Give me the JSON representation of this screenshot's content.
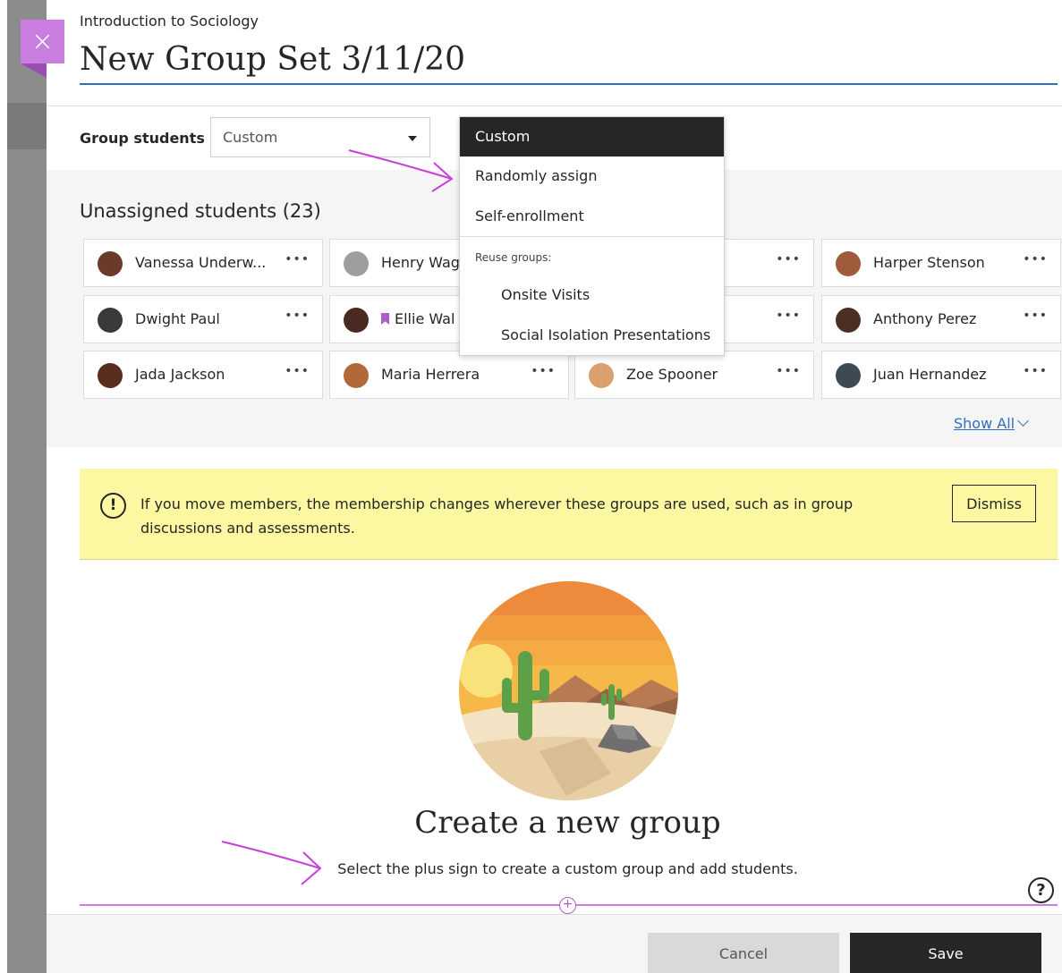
{
  "header": {
    "course_name": "Introduction to Sociology",
    "group_set_title": "New Group Set 3/11/20"
  },
  "grouping": {
    "label": "Group students",
    "selected": "Custom",
    "options": [
      {
        "label": "Custom",
        "selected": true
      },
      {
        "label": "Randomly assign",
        "selected": false
      },
      {
        "label": "Self-enrollment",
        "selected": false
      }
    ],
    "reuse_heading": "Reuse groups:",
    "reuse_options": [
      "Onsite Visits",
      "Social Isolation Presentations"
    ]
  },
  "students": {
    "heading": "Unassigned students (23)",
    "more_label": "•••",
    "show_all": "Show All",
    "list": [
      {
        "name": "Vanessa Underw...",
        "avatar_color": "#6b3a2a"
      },
      {
        "name": "Henry Wag",
        "avatar_color": "#9e9e9e"
      },
      {
        "name": "Harper Stenson",
        "avatar_color": "#a05a3c"
      },
      {
        "name": "Dwight Paul",
        "avatar_color": "#3a3a3a"
      },
      {
        "name": "Ellie Wal",
        "avatar_color": "#4a2a20",
        "flagged": true
      },
      {
        "name": "Anthony Perez",
        "avatar_color": "#4a3024"
      },
      {
        "name": "Jada Jackson",
        "avatar_color": "#5a2e1e"
      },
      {
        "name": "Maria Herrera",
        "avatar_color": "#b06a3a"
      },
      {
        "name": "Zoe Spooner",
        "avatar_color": "#d9a070"
      },
      {
        "name": "Juan Hernandez",
        "avatar_color": "#3e4a52"
      }
    ]
  },
  "notice": {
    "message": "If you move members, the membership changes wherever these groups are used, such as in group discussions and assessments.",
    "dismiss_label": "Dismiss"
  },
  "empty_state": {
    "title": "Create a new group",
    "hint": "Select the plus sign to create a custom group and add students."
  },
  "footer": {
    "cancel_label": "Cancel",
    "save_label": "Save"
  },
  "colors": {
    "accent_purple": "#c97ee0",
    "title_underline": "#2f6fbf",
    "notice_bg": "#fbf8a1",
    "save_bg": "#262626"
  },
  "icons": [
    "close-icon",
    "chevron-down-icon",
    "more-options-icon",
    "warning-icon",
    "help-icon",
    "plus-circle-icon",
    "bookmark-flag-icon"
  ]
}
